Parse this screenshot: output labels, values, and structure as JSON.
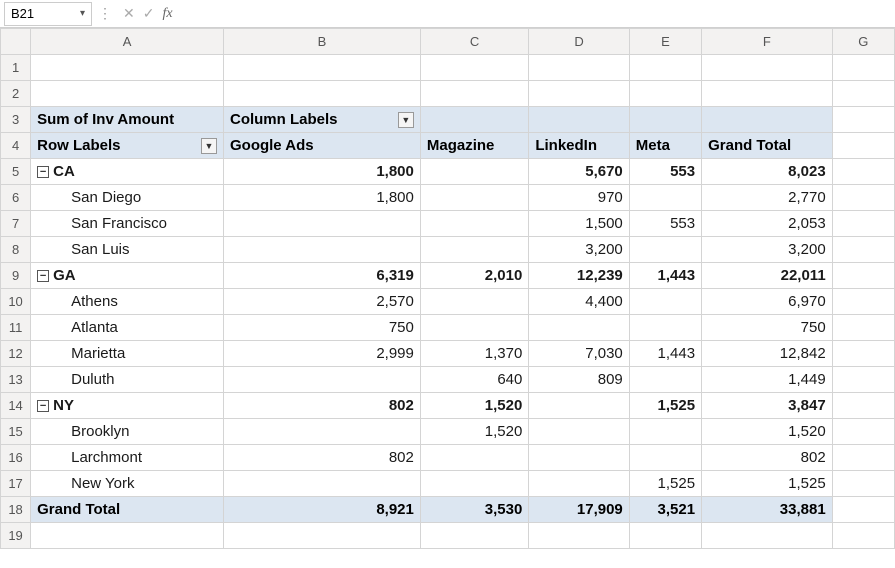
{
  "nameBox": "B21",
  "fxLabel": "fx",
  "formula": "",
  "columns": [
    "A",
    "B",
    "C",
    "D",
    "E",
    "F",
    "G"
  ],
  "rows": [
    "1",
    "2",
    "3",
    "4",
    "5",
    "6",
    "7",
    "8",
    "9",
    "10",
    "11",
    "12",
    "13",
    "14",
    "15",
    "16",
    "17",
    "18",
    "19"
  ],
  "pivot": {
    "measureLabel": "Sum of Inv Amount",
    "columnLabelsHeader": "Column Labels",
    "rowLabelsHeader": "Row Labels",
    "colHeaders": [
      "Google Ads",
      "Magazine",
      "LinkedIn",
      "Meta",
      "Grand Total"
    ],
    "groups": [
      {
        "label": "CA",
        "totals": [
          "1,800",
          "",
          "5,670",
          "553",
          "8,023"
        ],
        "children": [
          {
            "label": "San Diego",
            "vals": [
              "1,800",
              "",
              "970",
              "",
              "2,770"
            ]
          },
          {
            "label": "San Francisco",
            "vals": [
              "",
              "",
              "1,500",
              "553",
              "2,053"
            ]
          },
          {
            "label": "San Luis",
            "vals": [
              "",
              "",
              "3,200",
              "",
              "3,200"
            ]
          }
        ]
      },
      {
        "label": "GA",
        "totals": [
          "6,319",
          "2,010",
          "12,239",
          "1,443",
          "22,011"
        ],
        "children": [
          {
            "label": "Athens",
            "vals": [
              "2,570",
              "",
              "4,400",
              "",
              "6,970"
            ]
          },
          {
            "label": "Atlanta",
            "vals": [
              "750",
              "",
              "",
              "",
              "750"
            ]
          },
          {
            "label": "Marietta",
            "vals": [
              "2,999",
              "1,370",
              "7,030",
              "1,443",
              "12,842"
            ]
          },
          {
            "label": "Duluth",
            "vals": [
              "",
              "640",
              "809",
              "",
              "1,449"
            ]
          }
        ]
      },
      {
        "label": "NY",
        "totals": [
          "802",
          "1,520",
          "",
          "1,525",
          "3,847"
        ],
        "children": [
          {
            "label": "Brooklyn",
            "vals": [
              "",
              "1,520",
              "",
              "",
              "1,520"
            ]
          },
          {
            "label": "Larchmont",
            "vals": [
              "802",
              "",
              "",
              "",
              "802"
            ]
          },
          {
            "label": "New York",
            "vals": [
              "",
              "",
              "",
              "1,525",
              "1,525"
            ]
          }
        ]
      }
    ],
    "grandTotalLabel": "Grand Total",
    "grandTotals": [
      "8,921",
      "3,530",
      "17,909",
      "3,521",
      "33,881"
    ]
  },
  "chart_data": {
    "type": "table",
    "title": "Sum of Inv Amount",
    "columns": [
      "Google Ads",
      "Magazine",
      "LinkedIn",
      "Meta",
      "Grand Total"
    ],
    "rows": [
      {
        "group": "CA",
        "label": "CA",
        "values": [
          1800,
          null,
          5670,
          553,
          8023
        ]
      },
      {
        "group": "CA",
        "label": "San Diego",
        "values": [
          1800,
          null,
          970,
          null,
          2770
        ]
      },
      {
        "group": "CA",
        "label": "San Francisco",
        "values": [
          null,
          null,
          1500,
          553,
          2053
        ]
      },
      {
        "group": "CA",
        "label": "San Luis",
        "values": [
          null,
          null,
          3200,
          null,
          3200
        ]
      },
      {
        "group": "GA",
        "label": "GA",
        "values": [
          6319,
          2010,
          12239,
          1443,
          22011
        ]
      },
      {
        "group": "GA",
        "label": "Athens",
        "values": [
          2570,
          null,
          4400,
          null,
          6970
        ]
      },
      {
        "group": "GA",
        "label": "Atlanta",
        "values": [
          750,
          null,
          null,
          null,
          750
        ]
      },
      {
        "group": "GA",
        "label": "Marietta",
        "values": [
          2999,
          1370,
          7030,
          1443,
          12842
        ]
      },
      {
        "group": "GA",
        "label": "Duluth",
        "values": [
          null,
          640,
          809,
          null,
          1449
        ]
      },
      {
        "group": "NY",
        "label": "NY",
        "values": [
          802,
          1520,
          null,
          1525,
          3847
        ]
      },
      {
        "group": "NY",
        "label": "Brooklyn",
        "values": [
          null,
          1520,
          null,
          null,
          1520
        ]
      },
      {
        "group": "NY",
        "label": "Larchmont",
        "values": [
          802,
          null,
          null,
          null,
          802
        ]
      },
      {
        "group": "NY",
        "label": "New York",
        "values": [
          null,
          null,
          null,
          1525,
          1525
        ]
      },
      {
        "group": "Grand Total",
        "label": "Grand Total",
        "values": [
          8921,
          3530,
          17909,
          3521,
          33881
        ]
      }
    ]
  }
}
